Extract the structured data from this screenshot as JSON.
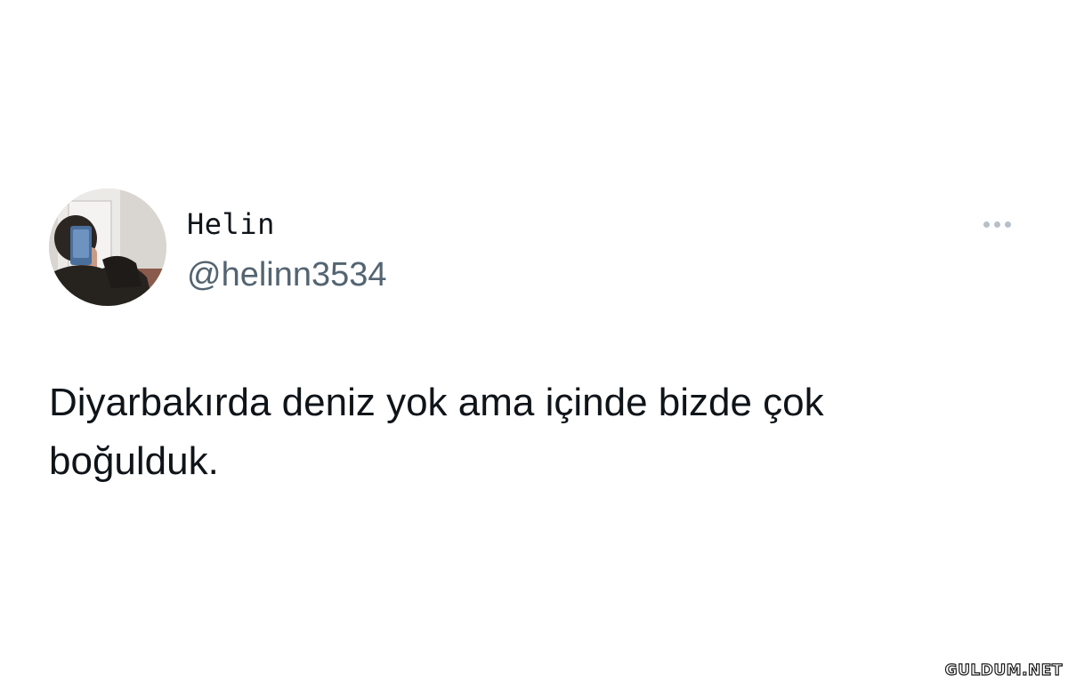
{
  "tweet": {
    "author": {
      "display_name": "Helin",
      "handle": "@helinn3534",
      "avatar_icon": "profile-photo"
    },
    "more_icon": "more-horizontal-icon",
    "text": "Diyarbakırda deniz yok ama içinde bizde çok\nboğulduk."
  },
  "watermark": {
    "text": "GULDUM.NET"
  },
  "colors": {
    "background": "#ffffff",
    "text_primary": "#0f1419",
    "text_secondary": "#536471",
    "more_icon": "#b7c0c8"
  }
}
